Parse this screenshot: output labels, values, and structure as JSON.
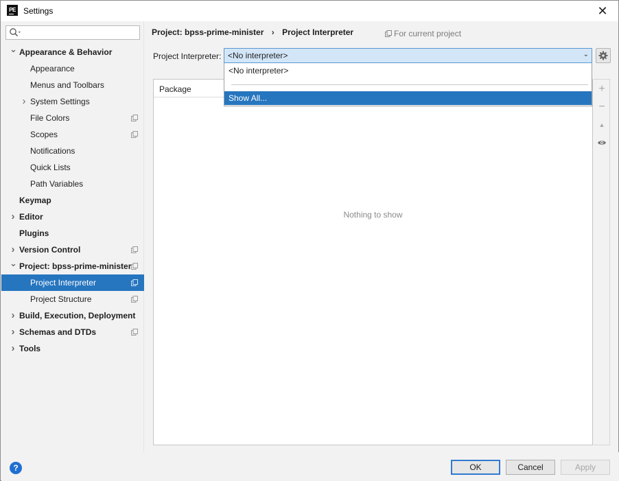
{
  "window": {
    "title": "Settings",
    "app_icon_text": "PE",
    "close_glyph": "✕"
  },
  "search": {
    "value": "",
    "placeholder": ""
  },
  "tree": [
    {
      "label": "Appearance & Behavior",
      "arrow": "expanded"
    },
    {
      "label": "Appearance"
    },
    {
      "label": "Menus and Toolbars"
    },
    {
      "label": "System Settings",
      "arrow": "collapsed"
    },
    {
      "label": "File Colors",
      "project_icon": true
    },
    {
      "label": "Scopes",
      "project_icon": true
    },
    {
      "label": "Notifications"
    },
    {
      "label": "Quick Lists"
    },
    {
      "label": "Path Variables"
    },
    {
      "label": "Keymap"
    },
    {
      "label": "Editor",
      "arrow": "collapsed"
    },
    {
      "label": "Plugins"
    },
    {
      "label": "Version Control",
      "arrow": "collapsed",
      "project_icon": true
    },
    {
      "label": "Project: bpss-prime-minister",
      "arrow": "expanded",
      "project_icon": true
    },
    {
      "label": "Project Interpreter",
      "selected": true,
      "project_icon": true
    },
    {
      "label": "Project Structure",
      "project_icon": true
    },
    {
      "label": "Build, Execution, Deployment",
      "arrow": "collapsed"
    },
    {
      "label": "Schemas and DTDs",
      "arrow": "collapsed",
      "project_icon": true
    },
    {
      "label": "Tools",
      "arrow": "collapsed"
    }
  ],
  "content": {
    "breadcrumb": [
      "Project: bpss-prime-minister",
      "Project Interpreter"
    ],
    "breadcrumb_sep": "›",
    "for_current_project": "For current project",
    "interpreter_label": "Project Interpreter:",
    "interpreter_value": "<No interpreter>",
    "table_header": "Package",
    "empty_text": "Nothing to show",
    "tools": {
      "add": "+",
      "remove": "−",
      "up": "▲",
      "show": "eye-icon"
    }
  },
  "dropdown": {
    "items": [
      "<No interpreter>",
      "Show All..."
    ],
    "highlighted": "Show All..."
  },
  "footer": {
    "help": "?",
    "ok": "OK",
    "cancel": "Cancel",
    "apply": "Apply"
  },
  "colors": {
    "selection": "#2675bf",
    "combo_bg": "#d3e6f8",
    "combo_border": "#5b97cf",
    "help": "#1f6fd1"
  }
}
